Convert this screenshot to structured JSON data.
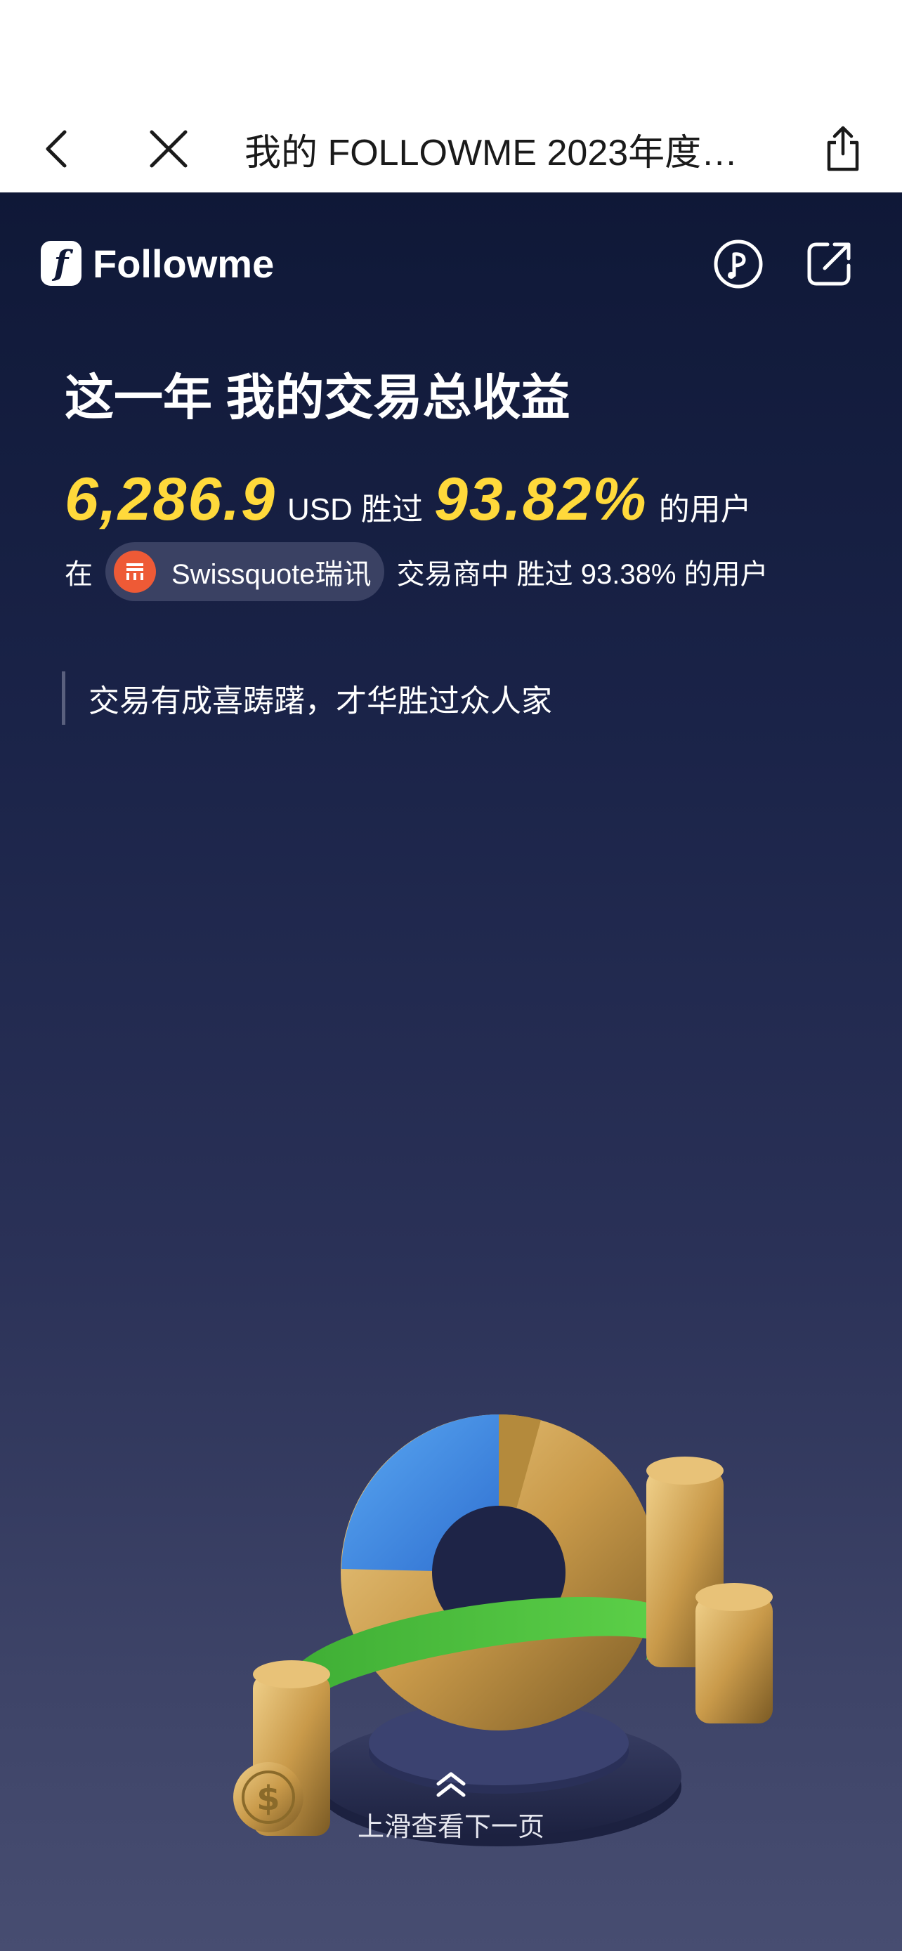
{
  "navbar": {
    "title": "我的 FOLLOWME 2023年度…",
    "back_icon": "chevron-left-icon",
    "close_icon": "close-icon",
    "share_icon": "share-icon"
  },
  "brand": {
    "logo_letter": "f",
    "name": "Followme"
  },
  "header_icons": [
    "music-icon",
    "external-link-icon"
  ],
  "headline": "这一年 我的交易总收益",
  "stats": {
    "profit": "6,286.9",
    "unit_text": "USD 胜过",
    "percent": "93.82%",
    "suffix": "的用户"
  },
  "broker": {
    "prefix": "在",
    "name": "Swissquote瑞讯",
    "suffix": "交易商中 胜过 93.38% 的用户"
  },
  "quote": "交易有成喜踌躇，才华胜过众人家",
  "swipe_hint": "上滑查看下一页",
  "colors": {
    "accent_yellow": "#ffd93b",
    "bg_top": "#0f1837",
    "bg_bottom": "#474d71",
    "broker_red": "#ee5a36",
    "pill": "#3a4163"
  }
}
